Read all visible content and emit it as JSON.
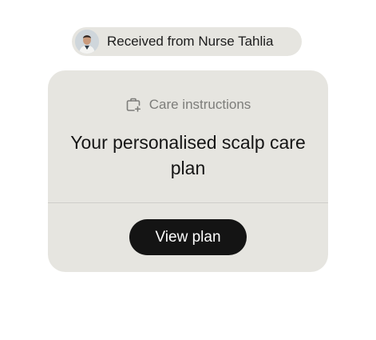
{
  "sender": {
    "avatar_icon": "nurse-avatar",
    "text": "Received from Nurse Tahlia"
  },
  "card": {
    "kicker_icon": "briefcase-plus-icon",
    "kicker": "Care instructions",
    "title": "Your personalised scalp care plan",
    "button_label": "View plan"
  },
  "colors": {
    "surface": "#e6e5e0",
    "button": "#141414",
    "button_text": "#ffffff",
    "kicker_text": "#7d7d7a",
    "title_text": "#151515"
  }
}
